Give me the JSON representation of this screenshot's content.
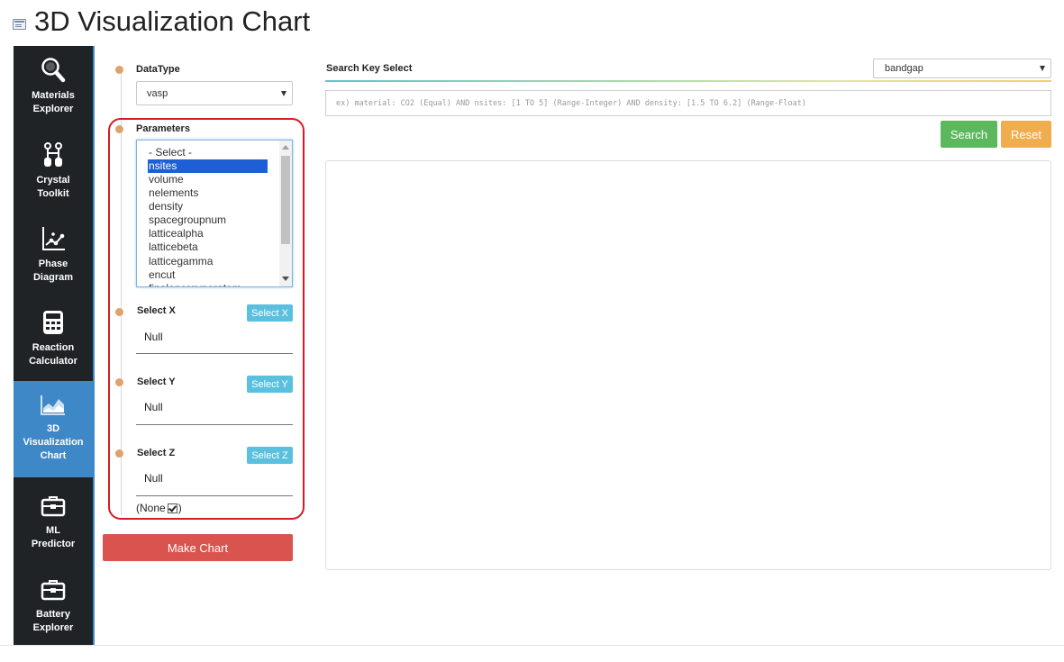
{
  "page": {
    "title": "3D Visualization Chart",
    "title_icon": "window-icon"
  },
  "sidebar": {
    "accent_color": "#3e88c7",
    "background": "#1f2326",
    "items": [
      {
        "label": "Materials\nExplorer",
        "icon": "magnifier-icon",
        "active": false
      },
      {
        "label": "Crystal\nToolkit",
        "icon": "molecule-icon",
        "active": false
      },
      {
        "label": "Phase\nDiagram",
        "icon": "phase-diagram-icon",
        "active": false
      },
      {
        "label": "Reaction\nCalculator",
        "icon": "calculator-icon",
        "active": false
      },
      {
        "label": "3D\nVisualization\nChart",
        "icon": "area-chart-icon",
        "active": true
      },
      {
        "label": "ML\nPredictor",
        "icon": "toolbox-icon",
        "active": false
      },
      {
        "label": "Battery\nExplorer",
        "icon": "toolbox-icon",
        "active": false
      }
    ]
  },
  "form": {
    "datatype": {
      "label": "DataType",
      "value": "vasp"
    },
    "parameters": {
      "label": "Parameters",
      "options": [
        "- Select -",
        "nsites",
        "volume",
        "nelements",
        "density",
        "spacegroupnum",
        "latticealpha",
        "latticebeta",
        "latticegamma",
        "encut",
        "finalenergyperatom"
      ],
      "selected": "nsites"
    },
    "select_x": {
      "label": "Select X",
      "button": "Select X",
      "value": "Null"
    },
    "select_y": {
      "label": "Select Y",
      "button": "Select Y",
      "value": "Null"
    },
    "select_z": {
      "label": "Select Z",
      "button": "Select Z",
      "value": "Null"
    },
    "none_option": {
      "prefix": "(None",
      "suffix": ")",
      "checked": true
    },
    "make_chart": "Make Chart"
  },
  "search": {
    "label": "Search Key Select",
    "key_value": "bandgap",
    "placeholder": "ex) material: CO2 (Equal) AND nsites: [1 TO 5] (Range-Integer) AND density: [1.5 TO 6.2] (Range-Float)",
    "search_button": "Search",
    "reset_button": "Reset"
  },
  "colors": {
    "make_chart": "#d9534f",
    "search": "#5cb85c",
    "reset": "#f0ad4e",
    "select_buttons": "#5bc0de",
    "highlight": "#d51b24"
  }
}
